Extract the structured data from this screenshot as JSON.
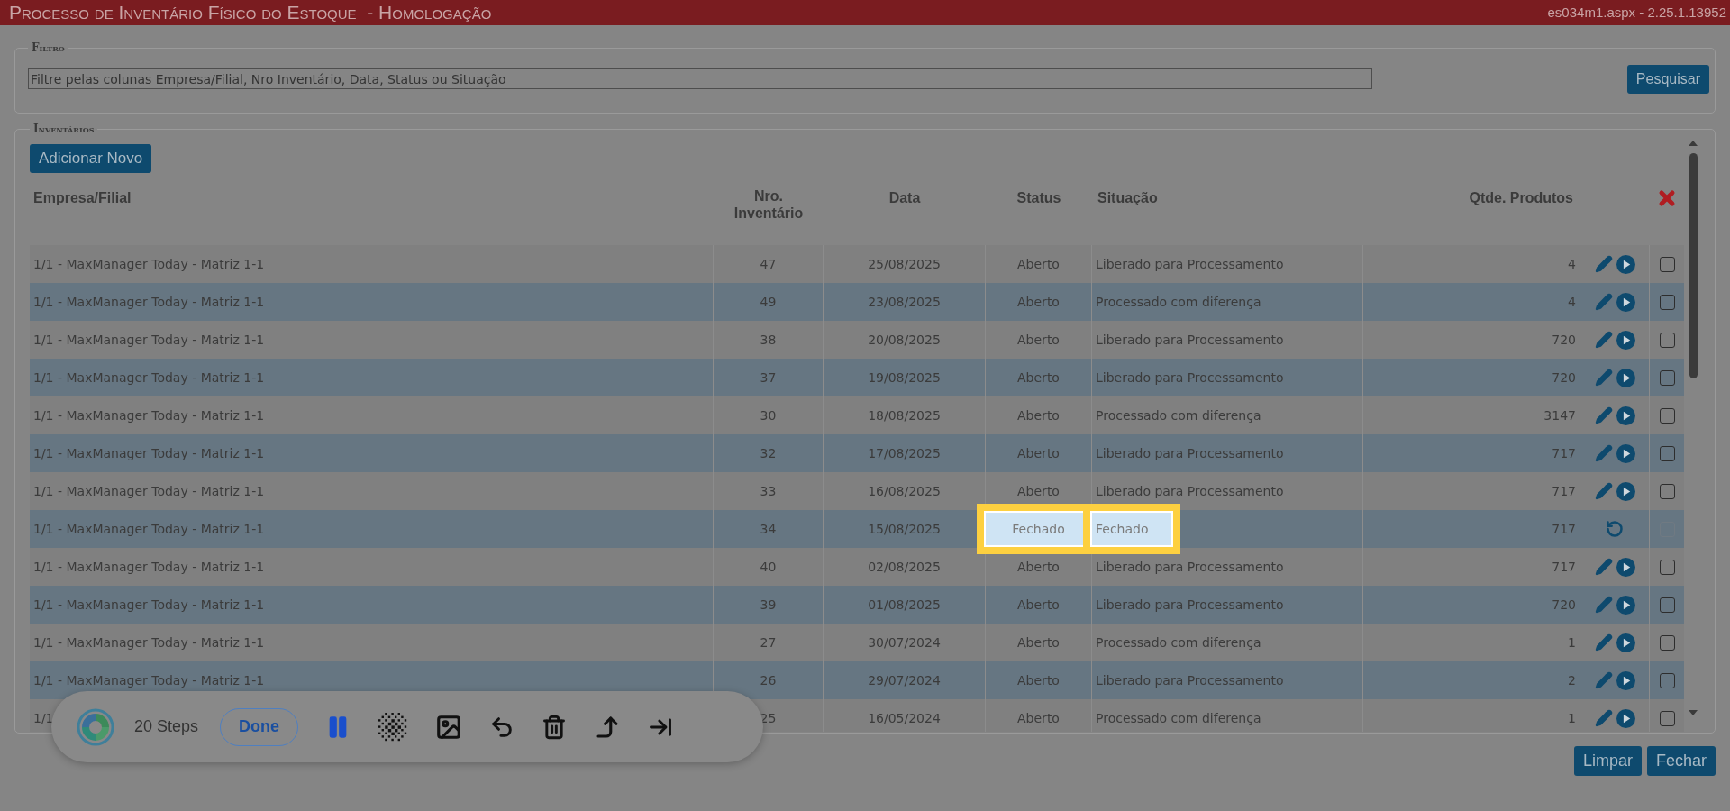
{
  "title_bar": {
    "title": "Processo de Inventário Físico do Estoque  - Homologação",
    "page_info": "es034m1.aspx - 2.25.1.13952"
  },
  "filter": {
    "legend": "Filtro",
    "placeholder": "Filtre pelas colunas Empresa/Filial, Nro Inventário, Data, Status ou Situação",
    "button": "Pesquisar"
  },
  "inventories": {
    "legend": "Inventários",
    "add_button": "Adicionar Novo",
    "columns": [
      "Empresa/Filial",
      "Nro. Inventário",
      "Data",
      "Status",
      "Situação",
      "Qtde. Produtos"
    ],
    "rows": [
      {
        "empresa": "1/1 - MaxManager Today - Matriz 1-1",
        "nro": "47",
        "data": "25/08/2025",
        "status": "Aberto",
        "situacao": "Liberado para Processamento",
        "qtde": "4",
        "kind": "open",
        "checked": false,
        "disabled": false,
        "highlighted": false
      },
      {
        "empresa": "1/1 - MaxManager Today - Matriz 1-1",
        "nro": "49",
        "data": "23/08/2025",
        "status": "Aberto",
        "situacao": "Processado com diferença",
        "qtde": "4",
        "kind": "open",
        "checked": false,
        "disabled": false,
        "highlighted": false
      },
      {
        "empresa": "1/1 - MaxManager Today - Matriz 1-1",
        "nro": "38",
        "data": "20/08/2025",
        "status": "Aberto",
        "situacao": "Liberado para Processamento",
        "qtde": "720",
        "kind": "open",
        "checked": false,
        "disabled": false,
        "highlighted": false
      },
      {
        "empresa": "1/1 - MaxManager Today - Matriz 1-1",
        "nro": "37",
        "data": "19/08/2025",
        "status": "Aberto",
        "situacao": "Liberado para Processamento",
        "qtde": "720",
        "kind": "open",
        "checked": false,
        "disabled": false,
        "highlighted": false
      },
      {
        "empresa": "1/1 - MaxManager Today - Matriz 1-1",
        "nro": "30",
        "data": "18/08/2025",
        "status": "Aberto",
        "situacao": "Processado com diferença",
        "qtde": "3147",
        "kind": "open",
        "checked": false,
        "disabled": false,
        "highlighted": false
      },
      {
        "empresa": "1/1 - MaxManager Today - Matriz 1-1",
        "nro": "32",
        "data": "17/08/2025",
        "status": "Aberto",
        "situacao": "Liberado para Processamento",
        "qtde": "717",
        "kind": "open",
        "checked": false,
        "disabled": false,
        "highlighted": false
      },
      {
        "empresa": "1/1 - MaxManager Today - Matriz 1-1",
        "nro": "33",
        "data": "16/08/2025",
        "status": "Aberto",
        "situacao": "Liberado para Processamento",
        "qtde": "717",
        "kind": "open",
        "checked": false,
        "disabled": false,
        "highlighted": false
      },
      {
        "empresa": "1/1 - MaxManager Today - Matriz 1-1",
        "nro": "34",
        "data": "15/08/2025",
        "status": "Fechado",
        "situacao": "Fechado",
        "qtde": "717",
        "kind": "closed",
        "checked": false,
        "disabled": true,
        "highlighted": true
      },
      {
        "empresa": "1/1 - MaxManager Today - Matriz 1-1",
        "nro": "40",
        "data": "02/08/2025",
        "status": "Aberto",
        "situacao": "Liberado para Processamento",
        "qtde": "717",
        "kind": "open",
        "checked": false,
        "disabled": false,
        "highlighted": false
      },
      {
        "empresa": "1/1 - MaxManager Today - Matriz 1-1",
        "nro": "39",
        "data": "01/08/2025",
        "status": "Aberto",
        "situacao": "Liberado para Processamento",
        "qtde": "720",
        "kind": "open",
        "checked": false,
        "disabled": false,
        "highlighted": false
      },
      {
        "empresa": "1/1 - MaxManager Today - Matriz 1-1",
        "nro": "27",
        "data": "30/07/2024",
        "status": "Aberto",
        "situacao": "Processado com diferença",
        "qtde": "1",
        "kind": "open",
        "checked": false,
        "disabled": false,
        "highlighted": false
      },
      {
        "empresa": "1/1 - MaxManager Today - Matriz 1-1",
        "nro": "26",
        "data": "29/07/2024",
        "status": "Aberto",
        "situacao": "Liberado para Processamento",
        "qtde": "2",
        "kind": "open",
        "checked": false,
        "disabled": false,
        "highlighted": false
      },
      {
        "empresa": "1/1",
        "nro": "25",
        "data": "16/05/2024",
        "status": "Aberto",
        "situacao": "Processado com diferença",
        "qtde": "1",
        "kind": "open",
        "checked": false,
        "disabled": false,
        "highlighted": false
      }
    ]
  },
  "footer_buttons": [
    "Limpar",
    "Fechar"
  ],
  "recorder": {
    "steps": "20 Steps",
    "done": "Done"
  }
}
